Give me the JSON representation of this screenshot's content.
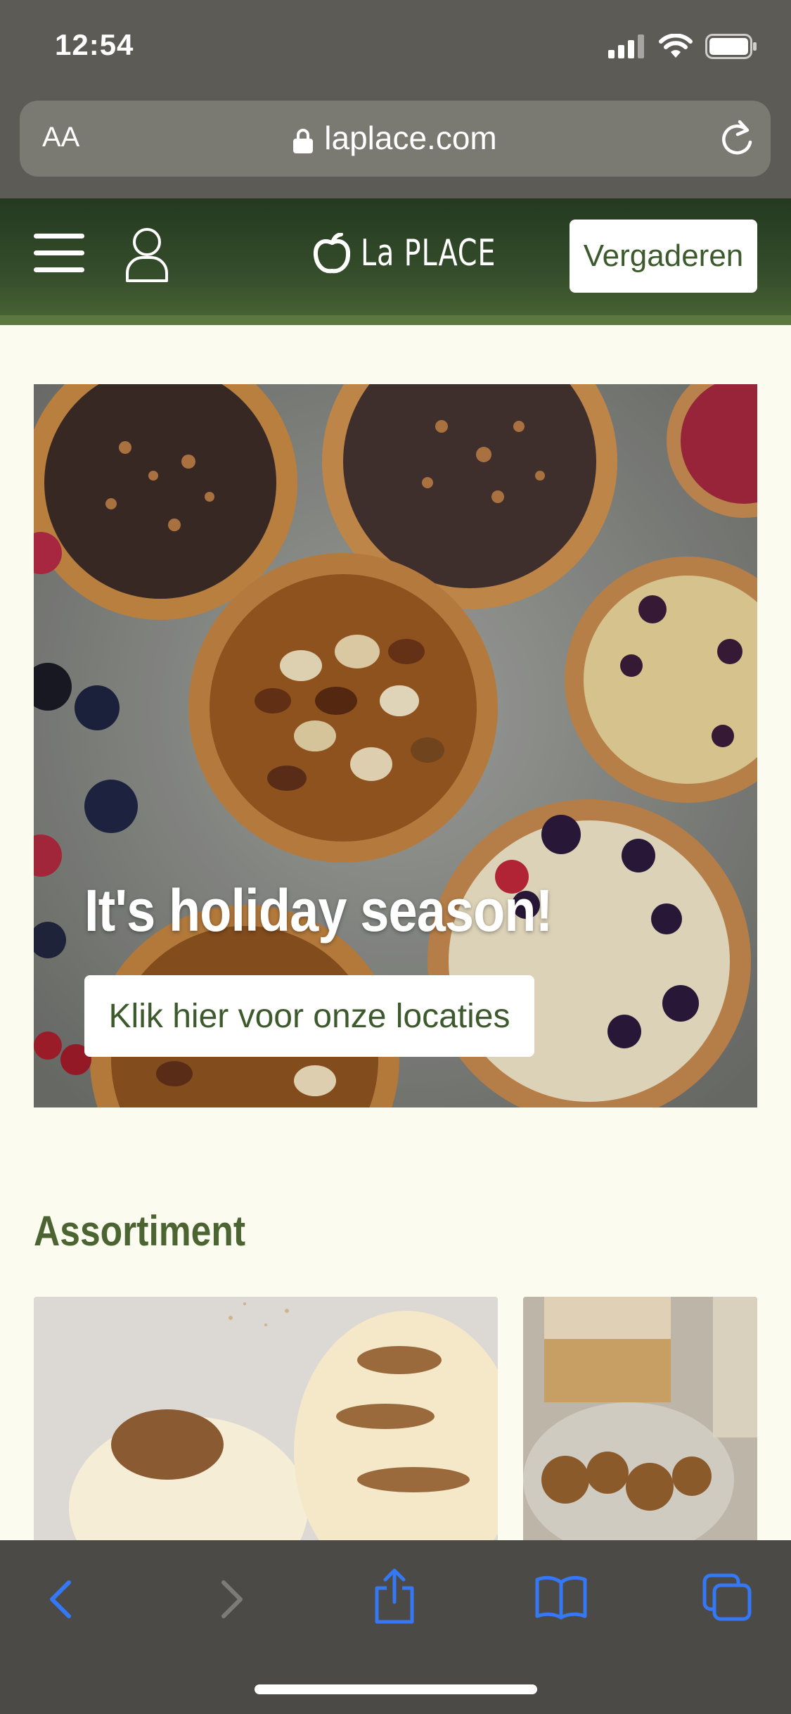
{
  "status_bar": {
    "time": "12:54"
  },
  "browser": {
    "text_size_label": "AA",
    "url": "laplace.com"
  },
  "site_header": {
    "logo_text": "La PLACE",
    "cta_label": "Vergaderen"
  },
  "hero": {
    "title": "It's holiday season!",
    "cta_label": "Klik hier voor onze locaties"
  },
  "assortment": {
    "heading": "Assortiment"
  },
  "colors": {
    "brand_green": "#3c5a2c",
    "page_background": "#fbfbf0",
    "safari_accent": "#3478f6"
  }
}
